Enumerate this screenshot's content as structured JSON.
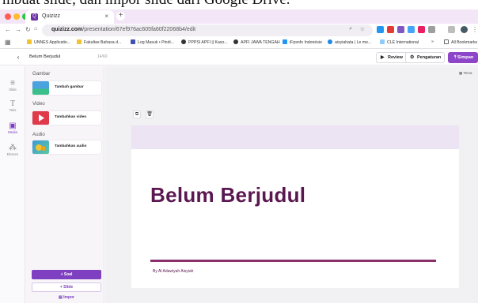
{
  "caption": "mbuat slide, dan impor slide dari Google Drive.",
  "browser": {
    "tab_title": "Quizizz",
    "tab_close": "×",
    "newtab": "+",
    "url_host": "quizizz.com",
    "url_path": "/presentation/67ef976ac605fa60f22068b4/edit",
    "bookmarks": [
      "UNNES Applicatio...",
      "Fakultas Bahasa d...",
      "Log Masuk • Pindi...",
      "PPPSI APFI || Kaso...",
      "APFI JAWA TENGAH",
      "iFpsnfo Indonésie",
      "aisyiahata | Le me...",
      "CLE International",
      "»",
      "All Bookmarks"
    ]
  },
  "header": {
    "back": "‹",
    "title": "Belum Berjudul",
    "char_count": "14/60",
    "review": "Review",
    "settings": "Pengaturan",
    "save": "Simpan"
  },
  "rail": {
    "items": [
      {
        "label": "Slide",
        "icon": "≡"
      },
      {
        "label": "Teks",
        "icon": "T"
      },
      {
        "label": "Media",
        "icon": "▣"
      },
      {
        "label": "Elemen",
        "icon": "⁂"
      }
    ]
  },
  "panel": {
    "sections": [
      {
        "title": "Gambar",
        "item": "Tambah gambar"
      },
      {
        "title": "Video",
        "item": "Tambahkan video"
      },
      {
        "title": "Audio",
        "item": "Tambahkan audio"
      }
    ],
    "add_question": "+ Soal",
    "add_slide": "+ Slide",
    "import": "Impor"
  },
  "canvas": {
    "theme": "Tema",
    "slide_title": "Belum Berjudul",
    "byline": "By Al Adawiyah Aisyiah"
  },
  "colors": {
    "accent": "#8e46c9",
    "title": "#5b1750",
    "band": "#ece3f3"
  }
}
